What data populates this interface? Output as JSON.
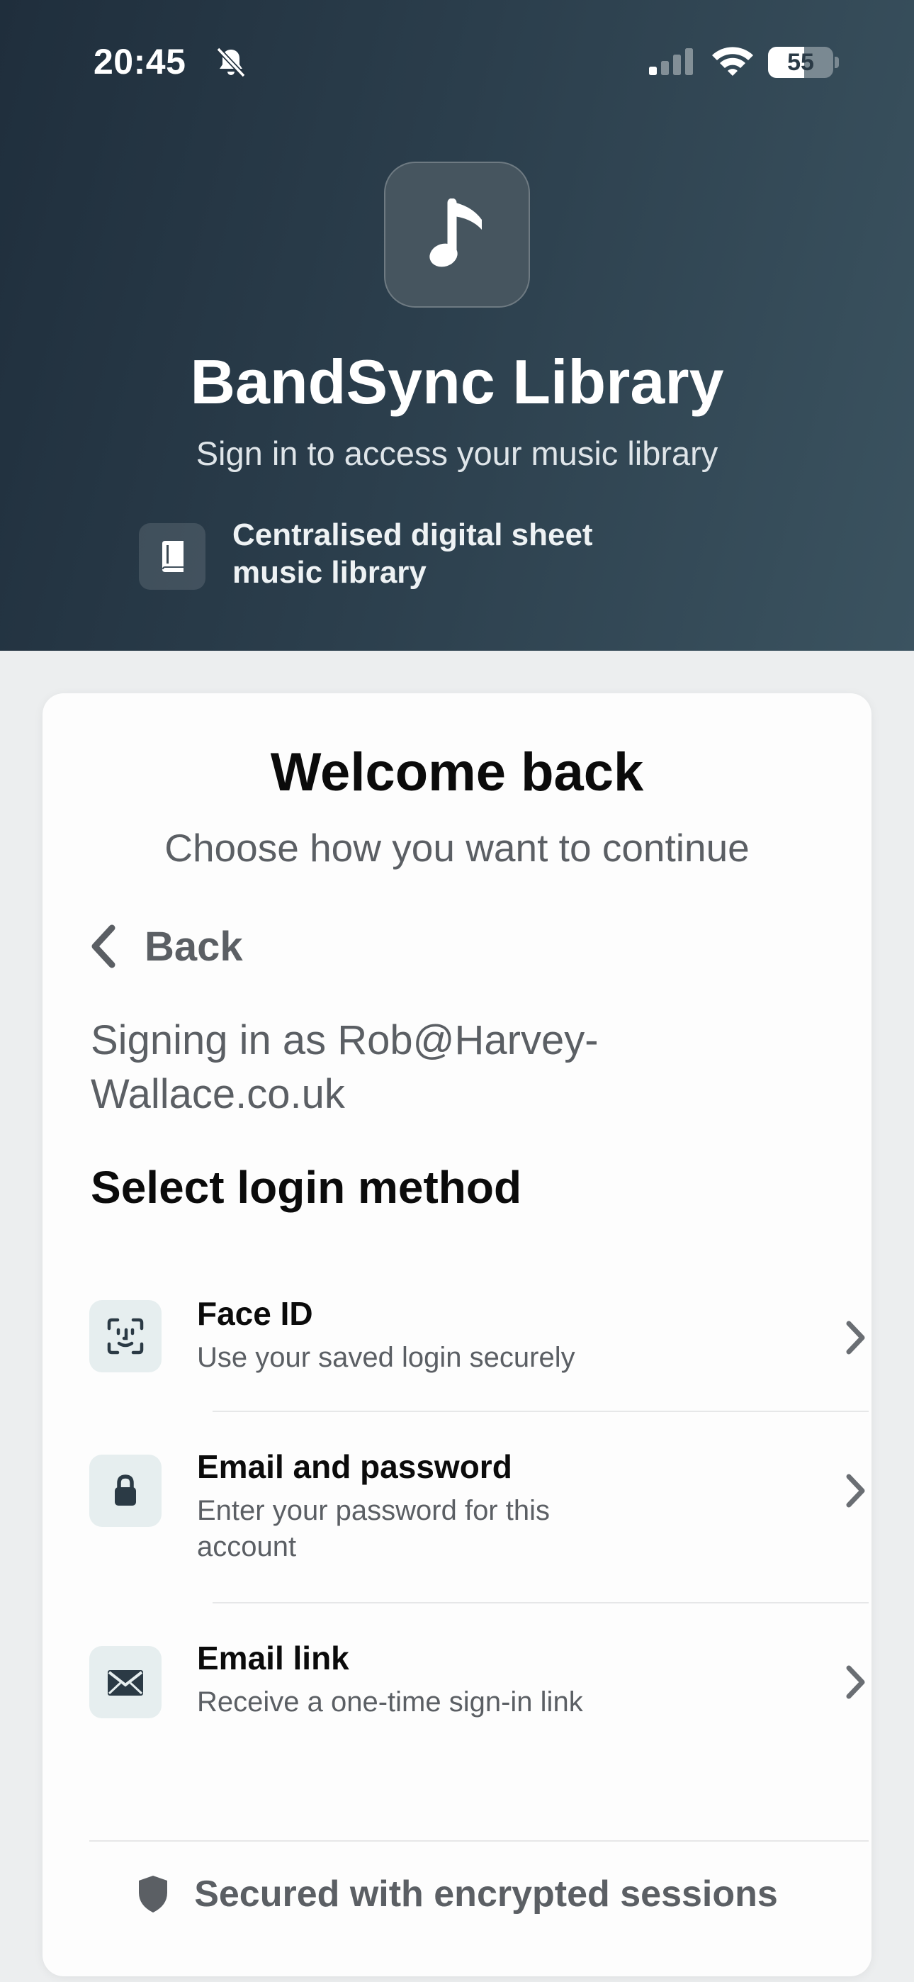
{
  "status_bar": {
    "time": "20:45",
    "battery": "55",
    "battery_level": 0.55
  },
  "hero": {
    "app_icon": "music-note-icon",
    "title": "BandSync Library",
    "subtitle": "Sign in to access your music library",
    "feature": {
      "icon": "book-icon",
      "text": "Centralised digital sheet music library"
    }
  },
  "card": {
    "title": "Welcome back",
    "subtitle": "Choose how you want to continue",
    "back_label": "Back",
    "signing_in_as": "Signing in as Rob@Harvey-Wallace.co.uk",
    "select_title": "Select login method",
    "methods": [
      {
        "icon": "face-id-icon",
        "title": "Face ID",
        "description": "Use your saved login securely"
      },
      {
        "icon": "lock-icon",
        "title": "Email and password",
        "description": "Enter your password for this account"
      },
      {
        "icon": "envelope-icon",
        "title": "Email link",
        "description": "Receive a one-time sign-in link"
      }
    ],
    "footer": "Secured with encrypted sessions"
  },
  "colors": {
    "hero_gradient_start": "#1f2e3c",
    "hero_gradient_end": "#3b5360",
    "card_background": "#fdfdfd",
    "icon_tile": "#e6eeef",
    "muted_text": "#5b5f64"
  }
}
